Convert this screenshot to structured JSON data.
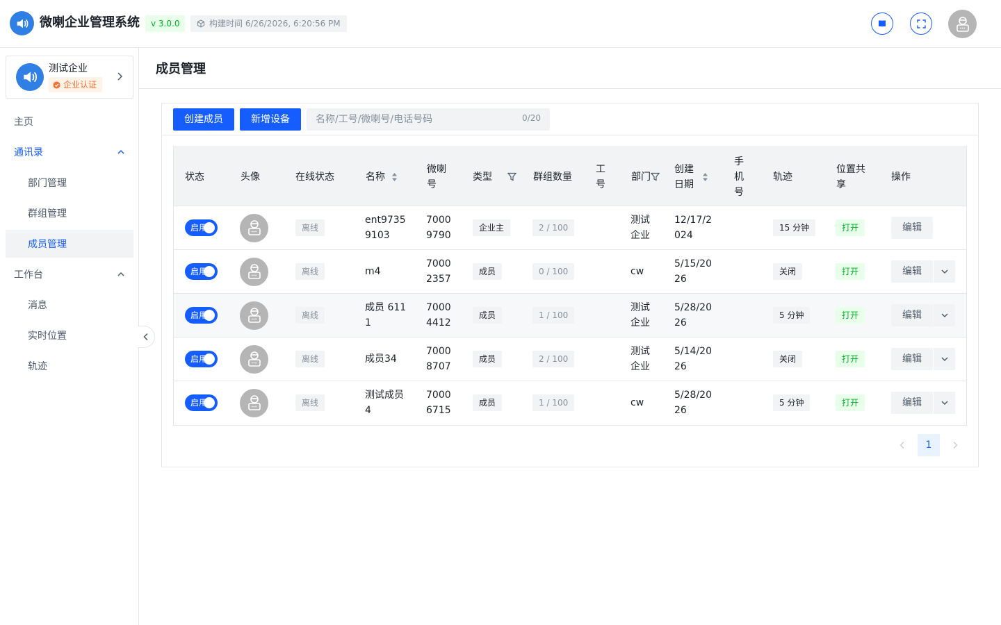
{
  "header": {
    "app_title": "微喇企业管理系统",
    "version": "v 3.0.0",
    "build_time": "构建时间 6/26/2026, 6:20:56 PM"
  },
  "sidebar": {
    "org_name": "测试企业",
    "org_badge": "企业认证",
    "items": [
      {
        "label": "主页"
      },
      {
        "label": "通讯录"
      },
      {
        "label": "部门管理"
      },
      {
        "label": "群组管理"
      },
      {
        "label": "成员管理"
      },
      {
        "label": "工作台"
      },
      {
        "label": "消息"
      },
      {
        "label": "实时位置"
      },
      {
        "label": "轨迹"
      }
    ]
  },
  "page": {
    "title": "成员管理",
    "create_member": "创建成员",
    "add_device": "新增设备",
    "search_placeholder": "名称/工号/微喇号/电话号码",
    "search_count": "0/20"
  },
  "table": {
    "columns": {
      "status": "状态",
      "avatar": "头像",
      "online": "在线状态",
      "name": "名称",
      "weila": "微喇号",
      "type": "类型",
      "groups": "群组数量",
      "jobno": "工号",
      "dept": "部门",
      "created": "创建日期",
      "phone": "手机号",
      "track": "轨迹",
      "share": "位置共享",
      "ops": "操作"
    },
    "rows": [
      {
        "status": "启用",
        "online": "离线",
        "name": "ent97359103",
        "weila": "70009790",
        "type": "企业主",
        "groups": "2 / 100",
        "dept": "测试企业",
        "created": "12/17/2024",
        "track": "15 分钟",
        "share": "打开",
        "edit": "编辑"
      },
      {
        "status": "启用",
        "online": "离线",
        "name": "m4",
        "weila": "70002357",
        "type": "成员",
        "groups": "0 / 100",
        "dept": "cw",
        "created": "5/15/2026",
        "track": "关闭",
        "share": "打开",
        "edit": "编辑"
      },
      {
        "status": "启用",
        "online": "离线",
        "name": "成员 6111",
        "weila": "70004412",
        "type": "成员",
        "groups": "1 / 100",
        "dept": "测试企业",
        "created": "5/28/2026",
        "track": "5 分钟",
        "share": "打开",
        "edit": "编辑"
      },
      {
        "status": "启用",
        "online": "离线",
        "name": "成员34",
        "weila": "70008707",
        "type": "成员",
        "groups": "2 / 100",
        "dept": "测试企业",
        "created": "5/14/2026",
        "track": "关闭",
        "share": "打开",
        "edit": "编辑"
      },
      {
        "status": "启用",
        "online": "离线",
        "name": "测试成员4",
        "weila": "70006715",
        "type": "成员",
        "groups": "1 / 100",
        "dept": "cw",
        "created": "5/28/2026",
        "track": "5 分钟",
        "share": "打开",
        "edit": "编辑"
      }
    ]
  },
  "pagination": {
    "current": "1"
  },
  "icons": {
    "logo": "speaker-logo-icon",
    "build": "cube-icon",
    "docs": "book-icon",
    "fullscreen": "fullscreen-icon",
    "avatar": "robot-avatar-icon"
  },
  "colors": {
    "primary": "#165dff",
    "success": "#00b42a",
    "warning": "#f77234"
  }
}
